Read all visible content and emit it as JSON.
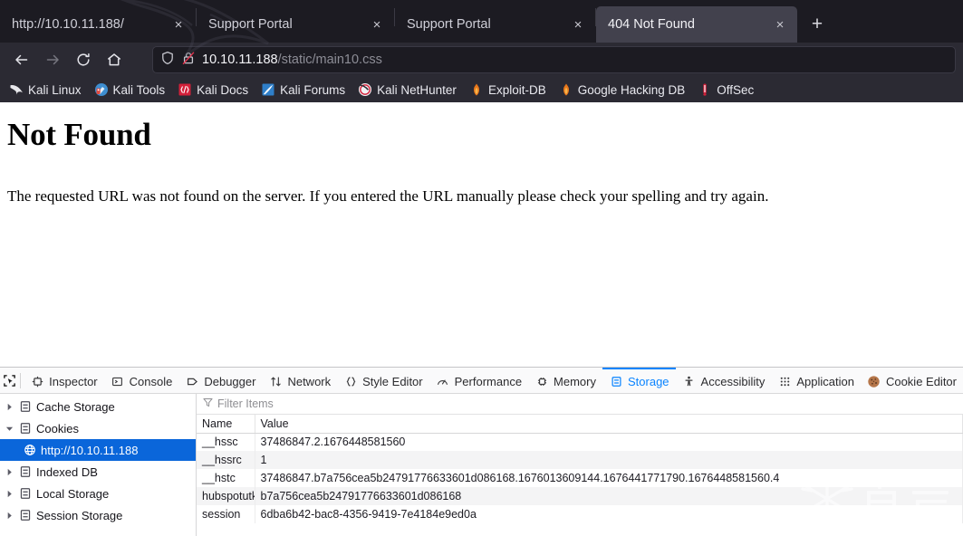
{
  "browser": {
    "tabs": [
      {
        "title": "http://10.10.11.188/",
        "active": false,
        "close_label": "×"
      },
      {
        "title": "Support Portal",
        "active": false,
        "close_label": "×"
      },
      {
        "title": "Support Portal",
        "active": false,
        "close_label": "×"
      },
      {
        "title": "404 Not Found",
        "active": true,
        "close_label": "×"
      }
    ],
    "new_tab_label": "+",
    "nav": {
      "back_icon": "back-arrow-icon",
      "forward_icon": "forward-arrow-icon",
      "reload_icon": "reload-icon",
      "home_icon": "home-icon"
    },
    "urlbar": {
      "shield_icon": "shield-icon",
      "lock_icon": "broken-lock-icon",
      "host": "10.10.11.188",
      "path": "/static/main10.css"
    },
    "bookmarks": [
      {
        "label": "Kali Linux",
        "icon": "kali-dragon-icon"
      },
      {
        "label": "Kali Tools",
        "icon": "kali-tools-icon"
      },
      {
        "label": "Kali Docs",
        "icon": "kali-docs-icon"
      },
      {
        "label": "Kali Forums",
        "icon": "kali-forums-icon"
      },
      {
        "label": "Kali NetHunter",
        "icon": "kali-nethunter-icon"
      },
      {
        "label": "Exploit-DB",
        "icon": "exploit-db-icon"
      },
      {
        "label": "Google Hacking DB",
        "icon": "google-hacking-db-icon"
      },
      {
        "label": "OffSec",
        "icon": "offsec-icon"
      }
    ]
  },
  "page": {
    "heading": "Not Found",
    "body": "The requested URL was not found on the server. If you entered the URL manually please check your spelling and try again."
  },
  "devtools": {
    "picker_icon": "element-picker-icon",
    "tabs": [
      {
        "label": "Inspector",
        "icon": "inspector-icon",
        "active": false
      },
      {
        "label": "Console",
        "icon": "console-icon",
        "active": false
      },
      {
        "label": "Debugger",
        "icon": "debugger-icon",
        "active": false
      },
      {
        "label": "Network",
        "icon": "network-icon",
        "active": false
      },
      {
        "label": "Style Editor",
        "icon": "style-editor-icon",
        "active": false
      },
      {
        "label": "Performance",
        "icon": "performance-icon",
        "active": false
      },
      {
        "label": "Memory",
        "icon": "memory-icon",
        "active": false
      },
      {
        "label": "Storage",
        "icon": "storage-icon",
        "active": true
      },
      {
        "label": "Accessibility",
        "icon": "accessibility-icon",
        "active": false
      },
      {
        "label": "Application",
        "icon": "application-icon",
        "active": false
      },
      {
        "label": "Cookie Editor",
        "icon": "cookie-icon",
        "active": false
      }
    ],
    "storage_tree": [
      {
        "label": "Cache Storage",
        "expanded": false,
        "selected": false,
        "child": false
      },
      {
        "label": "Cookies",
        "expanded": true,
        "selected": false,
        "child": false
      },
      {
        "label": "http://10.10.11.188",
        "expanded": null,
        "selected": true,
        "child": true
      },
      {
        "label": "Indexed DB",
        "expanded": false,
        "selected": false,
        "child": false
      },
      {
        "label": "Local Storage",
        "expanded": false,
        "selected": false,
        "child": false
      },
      {
        "label": "Session Storage",
        "expanded": false,
        "selected": false,
        "child": false
      }
    ],
    "filter": {
      "placeholder": "Filter Items",
      "value": "",
      "icon": "filter-icon"
    },
    "table": {
      "columns": [
        "Name",
        "Value"
      ],
      "rows": [
        {
          "name": "__hssc",
          "value": "37486847.2.1676448581560"
        },
        {
          "name": "__hssrc",
          "value": "1"
        },
        {
          "name": "__hstc",
          "value": "37486847.b7a756cea5b24791776633601d086168.1676013609144.1676441771790.1676448581560.4"
        },
        {
          "name": "hubspotutk",
          "value": "b7a756cea5b24791776633601d086168"
        },
        {
          "name": "session",
          "value": "6dba6b42-bac8-4356-9419-7e4184e9ed0a"
        }
      ]
    }
  },
  "watermark": {
    "text": "看雪",
    "icon": "snowflake-icon"
  },
  "colors": {
    "tabstrip_bg": "#1c1b22",
    "navbar_bg": "#2b2a33",
    "active_tab_bg": "#42414d",
    "accent_blue": "#0a84ff",
    "selection_blue": "#0a66da"
  }
}
